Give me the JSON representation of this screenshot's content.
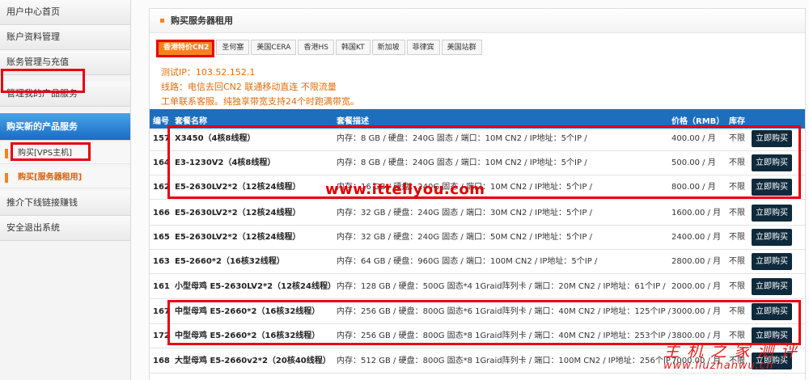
{
  "sidebar": {
    "items": [
      {
        "label": "用户中心首页"
      },
      {
        "label": "账户资料管理"
      },
      {
        "label": "账务管理与充值"
      },
      {
        "label": "管理我的产品服务"
      },
      {
        "label": "购买新的产品服务"
      },
      {
        "label": "购买[VPS主机]"
      },
      {
        "label": "购买[服务器租用]"
      },
      {
        "label": "推介下线链接赚钱"
      },
      {
        "label": "安全退出系统"
      }
    ]
  },
  "panel": {
    "title": "购买服务器租用"
  },
  "tabs": [
    "香港特价CN2",
    "圣何塞",
    "美国CERA",
    "香港HS",
    "韩国KT",
    "新加坡",
    "菲律宾",
    "美国站群"
  ],
  "info": {
    "test_ip": "测试IP：103.52.152.1",
    "line": "线路：电信去回CN2 联通移动直连 不限流量",
    "support": "工单联系客服。纯独享带宽支持24个时跑满带宽。"
  },
  "table": {
    "headers": {
      "id": "编号",
      "name": "套餐名称",
      "desc": "套餐描述",
      "price": "价格（RMB）",
      "stock": "库存"
    },
    "buy_label": "立即购买",
    "rows": [
      {
        "id": "157",
        "name": "X3450（4核8线程）",
        "desc": "内存：8 GB / 硬盘：240G 固态 / 端口：10M CN2 / IP地址：5个IP /",
        "price": "400.00 / 月",
        "stock": "不限"
      },
      {
        "id": "164",
        "name": "E3-1230V2（4核8线程）",
        "desc": "内存：8 GB / 硬盘：240G 固态 / 端口：10M CN2 / IP地址：5个IP /",
        "price": "500.00 / 月",
        "stock": "不限"
      },
      {
        "id": "162",
        "name": "E5-2630LV2*2（12核24线程）",
        "desc": "内存：16 GB / 硬盘：240G 固态 / 端口：10M CN2 / IP地址：5个IP /",
        "price": "800.00 / 月",
        "stock": "不限"
      },
      {
        "id": "166",
        "name": "E5-2630LV2*2（12核24线程）",
        "desc": "内存：32 GB / 硬盘：240G 固态 / 端口：30M CN2 / IP地址：5个IP /",
        "price": "1600.00 / 月",
        "stock": "不限"
      },
      {
        "id": "165",
        "name": "E5-2630LV2*2（12核24线程）",
        "desc": "内存：32 GB / 硬盘：240G 固态 / 端口：50M CN2 / IP地址：5个IP /",
        "price": "2400.00 / 月",
        "stock": "不限"
      },
      {
        "id": "163",
        "name": "E5-2660*2（16核32线程）",
        "desc": "内存：64 GB / 硬盘：960G 固态 / 端口：100M CN2 / IP地址：5个IP /",
        "price": "2800.00 / 月",
        "stock": "不限"
      },
      {
        "id": "161",
        "name": "小型母鸡 E5-2630LV2*2（12核24线程）",
        "desc": "内存：128 GB / 硬盘：500G 固态*4 1Graid阵列卡 / 端口：20M CN2 / IP地址：61个IP /",
        "price": "2000.00 / 月",
        "stock": "不限"
      },
      {
        "id": "167",
        "name": "中型母鸡 E5-2660*2（16核32线程）",
        "desc": "内存：256 GB / 硬盘：800G 固态*6 1Graid阵列卡 / 端口：40M CN2 / IP地址：125个IP /",
        "price": "3000.00 / 月",
        "stock": "不限"
      },
      {
        "id": "172",
        "name": "中型母鸡 E5-2660*2（16核32线程）",
        "desc": "内存：256 GB / 硬盘：800G 固态*8 1Graid阵列卡 / 端口：40M CN2 / IP地址：253个IP /",
        "price": "3800.00 / 月",
        "stock": "不限"
      },
      {
        "id": "168",
        "name": "大型母鸡 E5-2660v2*2（20核40线程）",
        "desc": "内存：512 GB / 硬盘：800G 固态*8 1Graid阵列卡 / 端口：100M CN2 / IP地址：256个IP /",
        "price": "7000.00 / 月",
        "stock": "不限"
      }
    ]
  },
  "watermarks": {
    "site": "www.ittellyou.com",
    "corner_cn": "主机之家测评",
    "corner_en": "www.liuzhanwu.cn"
  },
  "colors": {
    "accent": "#f5821f",
    "header_blue": "#1d6fbe",
    "buy_button": "#0e2a3c",
    "highlight_red": "#e8000f"
  }
}
